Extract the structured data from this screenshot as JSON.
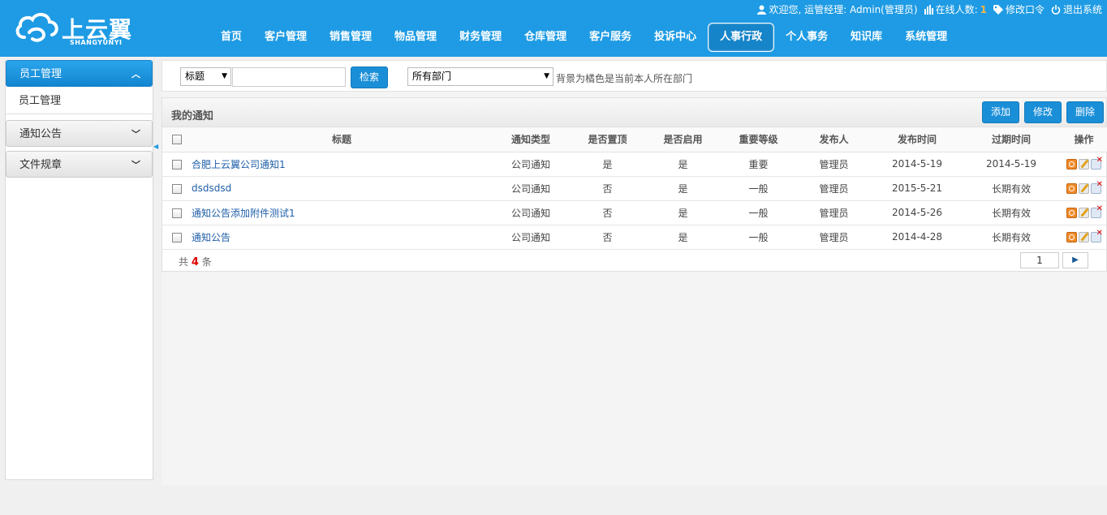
{
  "header": {
    "logo_text": "上云翼",
    "logo_sub": "SHANGYUNYI",
    "welcome": "欢迎您, 运管经理: Admin(管理员)",
    "online_label": "在线人数:",
    "online_count": "1",
    "change_password": "修改口令",
    "logout": "退出系统",
    "nav": [
      "首页",
      "客户管理",
      "销售管理",
      "物品管理",
      "财务管理",
      "仓库管理",
      "客户服务",
      "投诉中心",
      "人事行政",
      "个人事务",
      "知识库",
      "系统管理"
    ],
    "active_nav_index": 8
  },
  "sidebar": {
    "groups": [
      {
        "label": "员工管理",
        "open": true,
        "sub": [
          "员工管理"
        ]
      },
      {
        "label": "通知公告",
        "open": false
      },
      {
        "label": "文件规章",
        "open": false
      }
    ]
  },
  "filter": {
    "field_select": "标题",
    "search_value": "",
    "search_button": "检索",
    "dept_select": "所有部门",
    "hint": "背景为橘色是当前本人所在部门"
  },
  "panel": {
    "title": "我的通知",
    "add_button": "添加",
    "edit_button": "修改",
    "delete_button": "删除"
  },
  "table": {
    "headers": [
      "标题",
      "通知类型",
      "是否置顶",
      "是否启用",
      "重要等级",
      "发布人",
      "发布时间",
      "过期时间",
      "操作"
    ],
    "rows": [
      {
        "title": "合肥上云翼公司通知1",
        "type": "公司通知",
        "top": "是",
        "enabled": "是",
        "level": "重要",
        "publisher": "管理员",
        "publish_time": "2014-5-19",
        "expire_time": "2014-5-19"
      },
      {
        "title": "dsdsdsd",
        "type": "公司通知",
        "top": "否",
        "enabled": "是",
        "level": "一般",
        "publisher": "管理员",
        "publish_time": "2015-5-21",
        "expire_time": "长期有效"
      },
      {
        "title": "通知公告添加附件测试1",
        "type": "公司通知",
        "top": "否",
        "enabled": "是",
        "level": "一般",
        "publisher": "管理员",
        "publish_time": "2014-5-26",
        "expire_time": "长期有效"
      },
      {
        "title": "通知公告",
        "type": "公司通知",
        "top": "否",
        "enabled": "是",
        "level": "一般",
        "publisher": "管理员",
        "publish_time": "2014-4-28",
        "expire_time": "长期有效"
      }
    ]
  },
  "pagination": {
    "total_prefix": "共",
    "total_count": "4",
    "total_suffix": "条",
    "current_page": "1",
    "next_glyph": "▶"
  },
  "colors": {
    "header_bg": "#1e9be4",
    "primary_button": "#1a8fd8",
    "link": "#1f5fa8",
    "total_highlight": "#dd0000"
  }
}
